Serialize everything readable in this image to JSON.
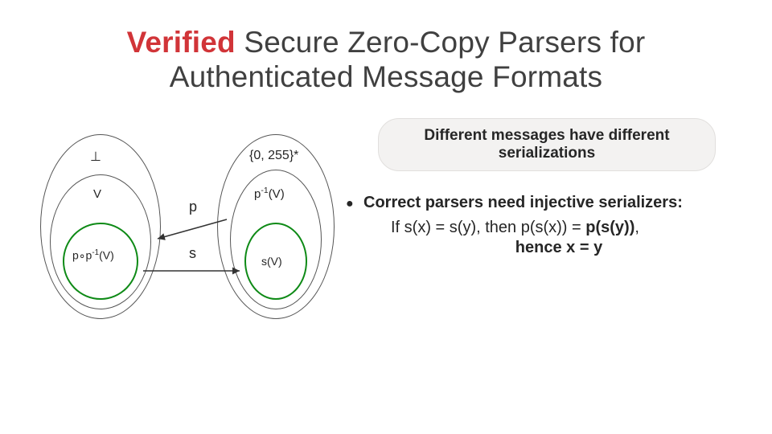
{
  "title": {
    "emph": "Verified",
    "rest1": " Secure Zero-Copy Parsers for",
    "line2": "Authenticated Message Formats"
  },
  "diagram": {
    "left_outer": "⊥",
    "left_mid": "V",
    "left_inner_a": "p∘p",
    "left_inner_b": "-1",
    "left_inner_c": "(V)",
    "right_outer": "{0, 255}*",
    "right_mid_a": "p",
    "right_mid_b": "-1",
    "right_mid_c": "(V)",
    "right_inner": "s(V)",
    "p_arrow": "p",
    "s_arrow": "s"
  },
  "bubble": {
    "line1": "Different messages have different",
    "line2": "serializations"
  },
  "bullet": {
    "lead": "Correct parsers need ",
    "strong": "injective serializers",
    "tail": ":"
  },
  "line2": {
    "a": "If s(x) = s(y), then p(s(x)) = ",
    "b": "p(s(y))",
    "c": ","
  },
  "line3": "hence x = y"
}
